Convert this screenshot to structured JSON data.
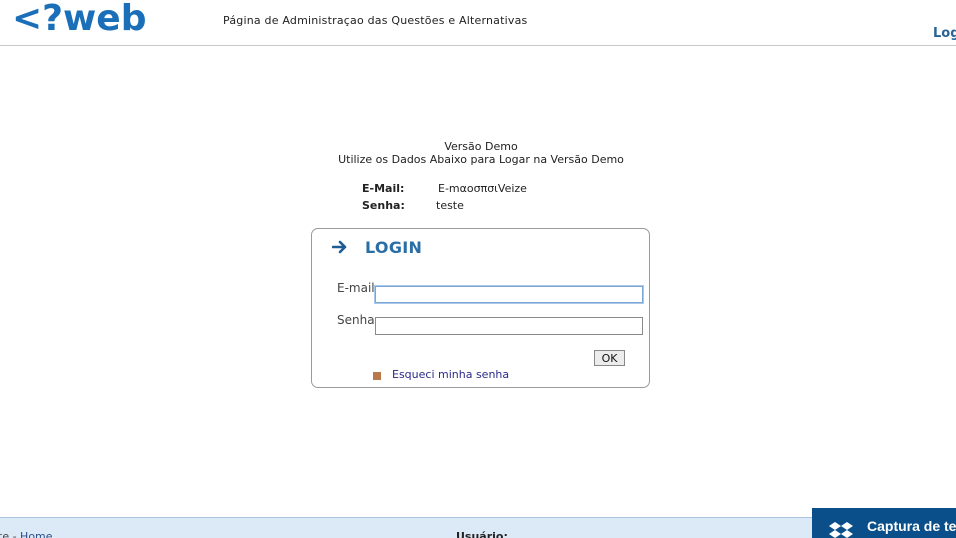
{
  "header": {
    "logo_text": "<?web",
    "title": "Página de Administraçao das Questões e Alternativas",
    "logout_label": "Log"
  },
  "demo": {
    "line1": "Versão Demo",
    "line2": "Utilize os Dados Abaixo para Logar na Versão Demo",
    "email_label": "E-Mail:",
    "email_value": "E-mαοσπσιVeize",
    "senha_label": "Senha:",
    "senha_value": "teste"
  },
  "login": {
    "title": "LOGIN",
    "email_label": "E-mail:",
    "email_value": "",
    "senha_label": "Senha:",
    "senha_value": "",
    "ok_label": "OK",
    "forgot_label": "Esqueci minha senha"
  },
  "footer": {
    "breadcrumb_prefix": "te - ",
    "breadcrumb_home": "Home",
    "user_label": "Usuário:"
  },
  "toast": {
    "text": "Captura de te"
  },
  "colors": {
    "accent": "#2a6ea6",
    "footer_bg": "#dce9f7",
    "toast_bg": "#0b4f8a",
    "bullet": "#b87a4b"
  },
  "icons": {
    "logo": "web-logo-icon",
    "login_arrow": "arrow-right-icon",
    "bullet": "square-bullet-icon",
    "toast": "dropbox-icon"
  }
}
